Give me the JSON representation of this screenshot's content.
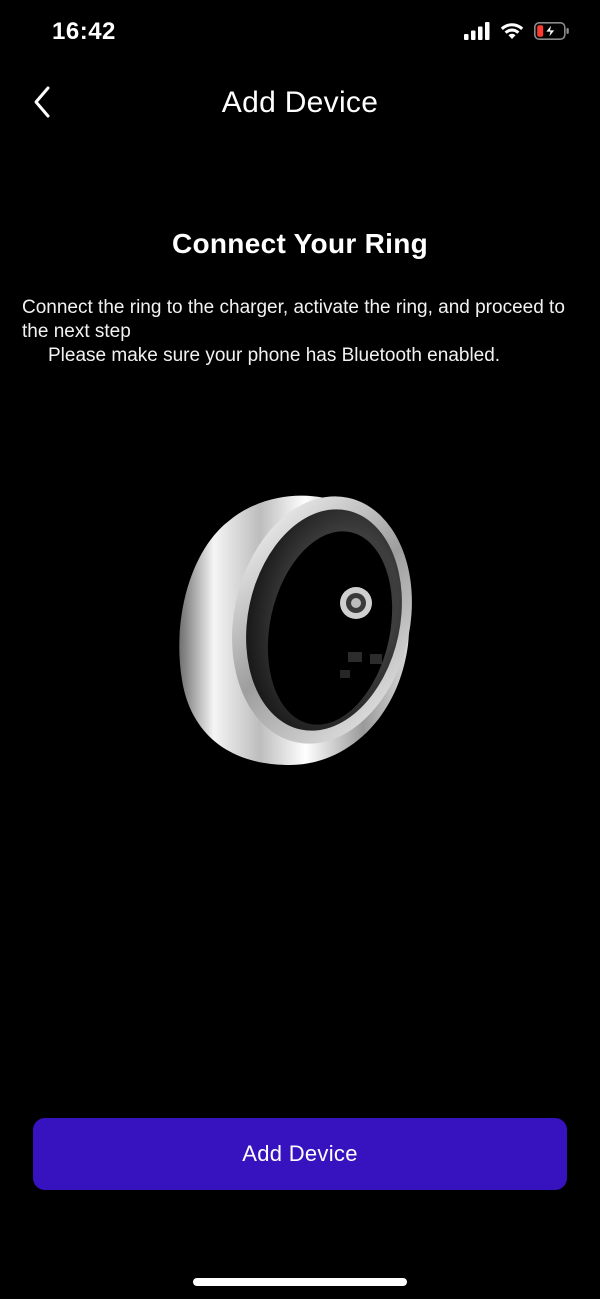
{
  "status_bar": {
    "time": "16:42",
    "icons": [
      "cellular-signal-icon",
      "wifi-icon",
      "battery-charging-icon"
    ],
    "battery_low_color": "#ff3b30"
  },
  "nav": {
    "back_icon": "chevron-left-icon",
    "title": "Add Device"
  },
  "content": {
    "heading": "Connect Your Ring",
    "description_line1": "Connect the ring to the charger, activate the ring, and proceed to the next step",
    "description_line2": "Please make sure your phone has Bluetooth enabled.",
    "image": "smart-ring-image"
  },
  "footer": {
    "primary_button_label": "Add Device",
    "accent_color": "#3713c0"
  }
}
